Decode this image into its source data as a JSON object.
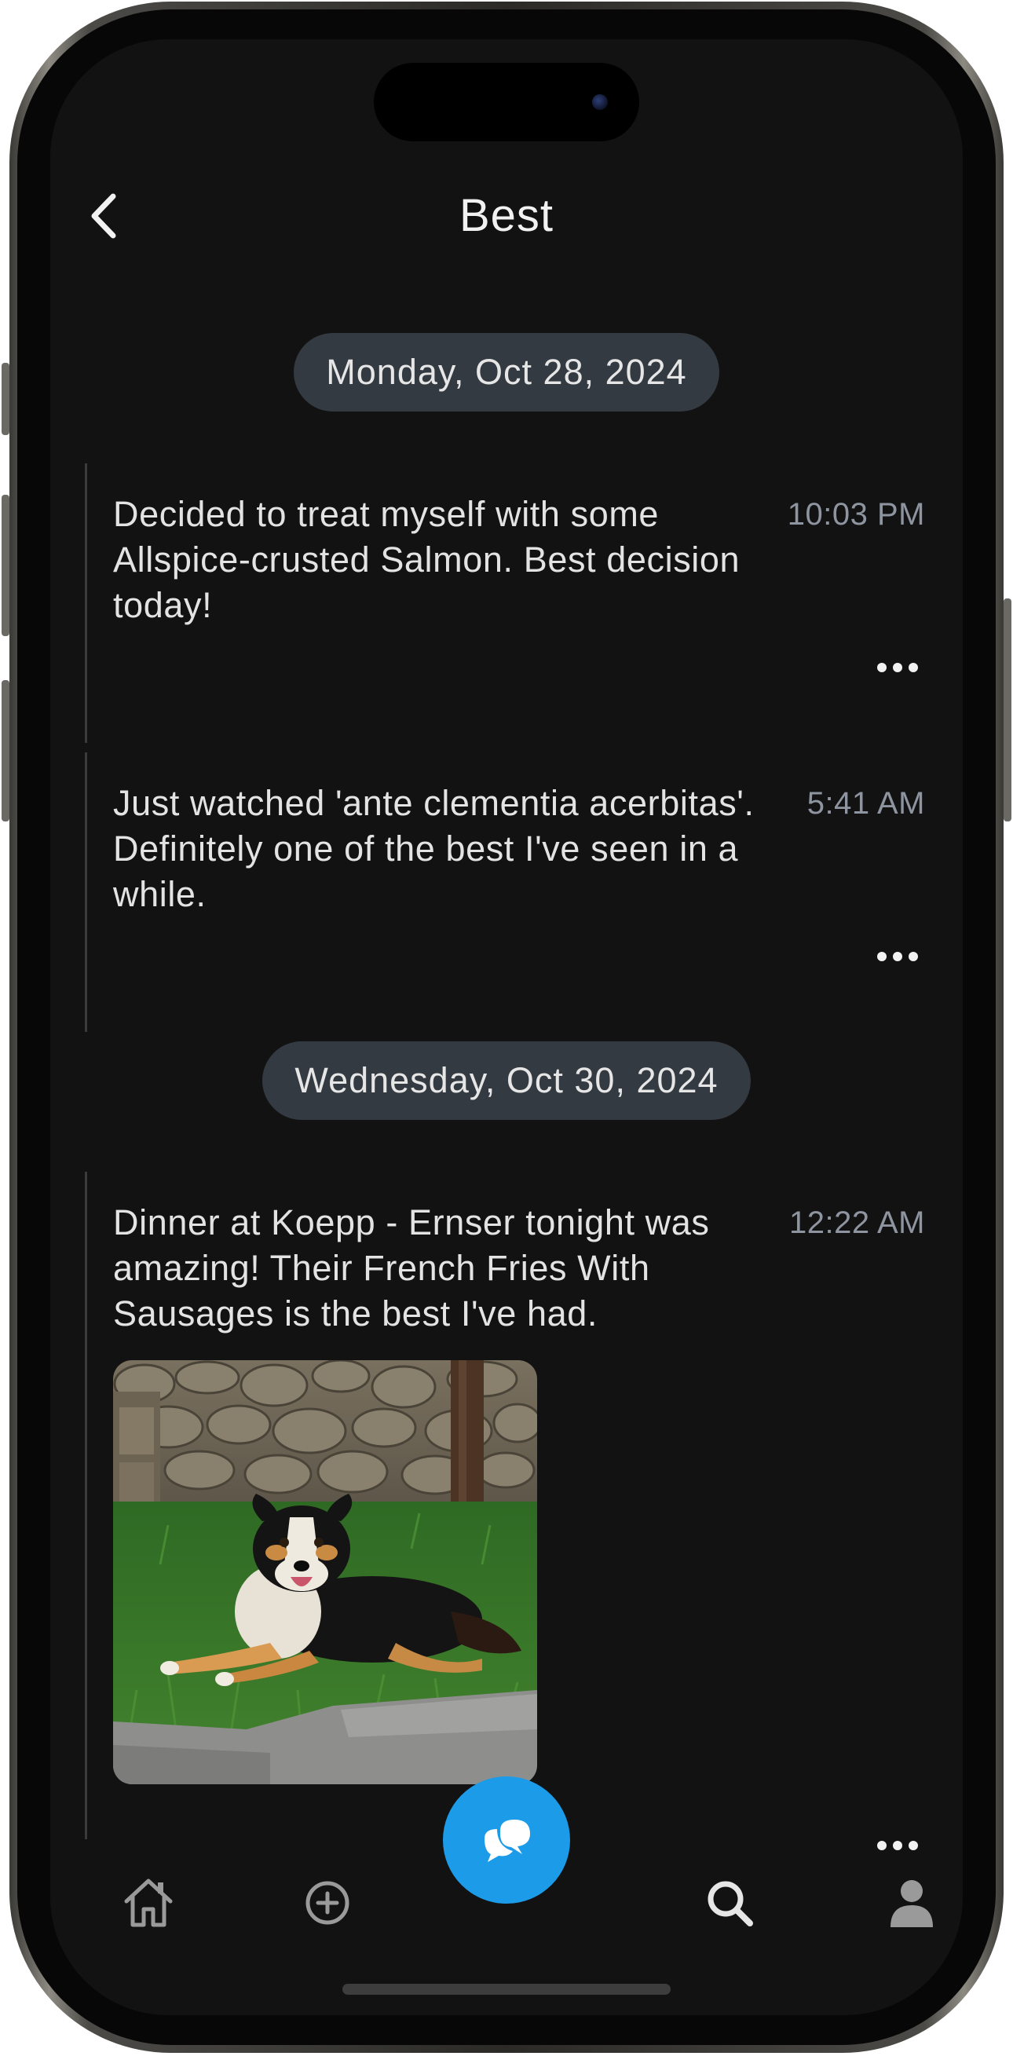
{
  "header": {
    "title": "Best",
    "back_icon": "chevron-left-icon"
  },
  "groups": [
    {
      "date": "Monday, Oct 28, 2024",
      "entries": [
        {
          "text": "Decided to treat myself with some Allspice-crusted Salmon. Best decision today!",
          "time": "10:03 PM"
        },
        {
          "text": "Just watched 'ante clementia acerbitas'. Definitely one of the best I've seen in a while.",
          "time": "5:41 AM"
        }
      ]
    },
    {
      "date": "Wednesday, Oct 30, 2024",
      "entries": [
        {
          "text": "Dinner at Koepp - Ernser tonight was amazing! Their French Fries With Sausages is the best I've had.",
          "time": "12:22 AM",
          "photo": "dog-lying-on-grass-photo"
        }
      ]
    }
  ],
  "tabbar": {
    "items": [
      "home-icon",
      "add-circle-icon",
      "chat-bubbles-icon",
      "search-icon",
      "profile-icon"
    ],
    "accent": "#1c9be9"
  },
  "colors": {
    "background": "#121212",
    "pill": "#343a41",
    "text": "#e3e3e3",
    "time": "#8e95a0"
  }
}
